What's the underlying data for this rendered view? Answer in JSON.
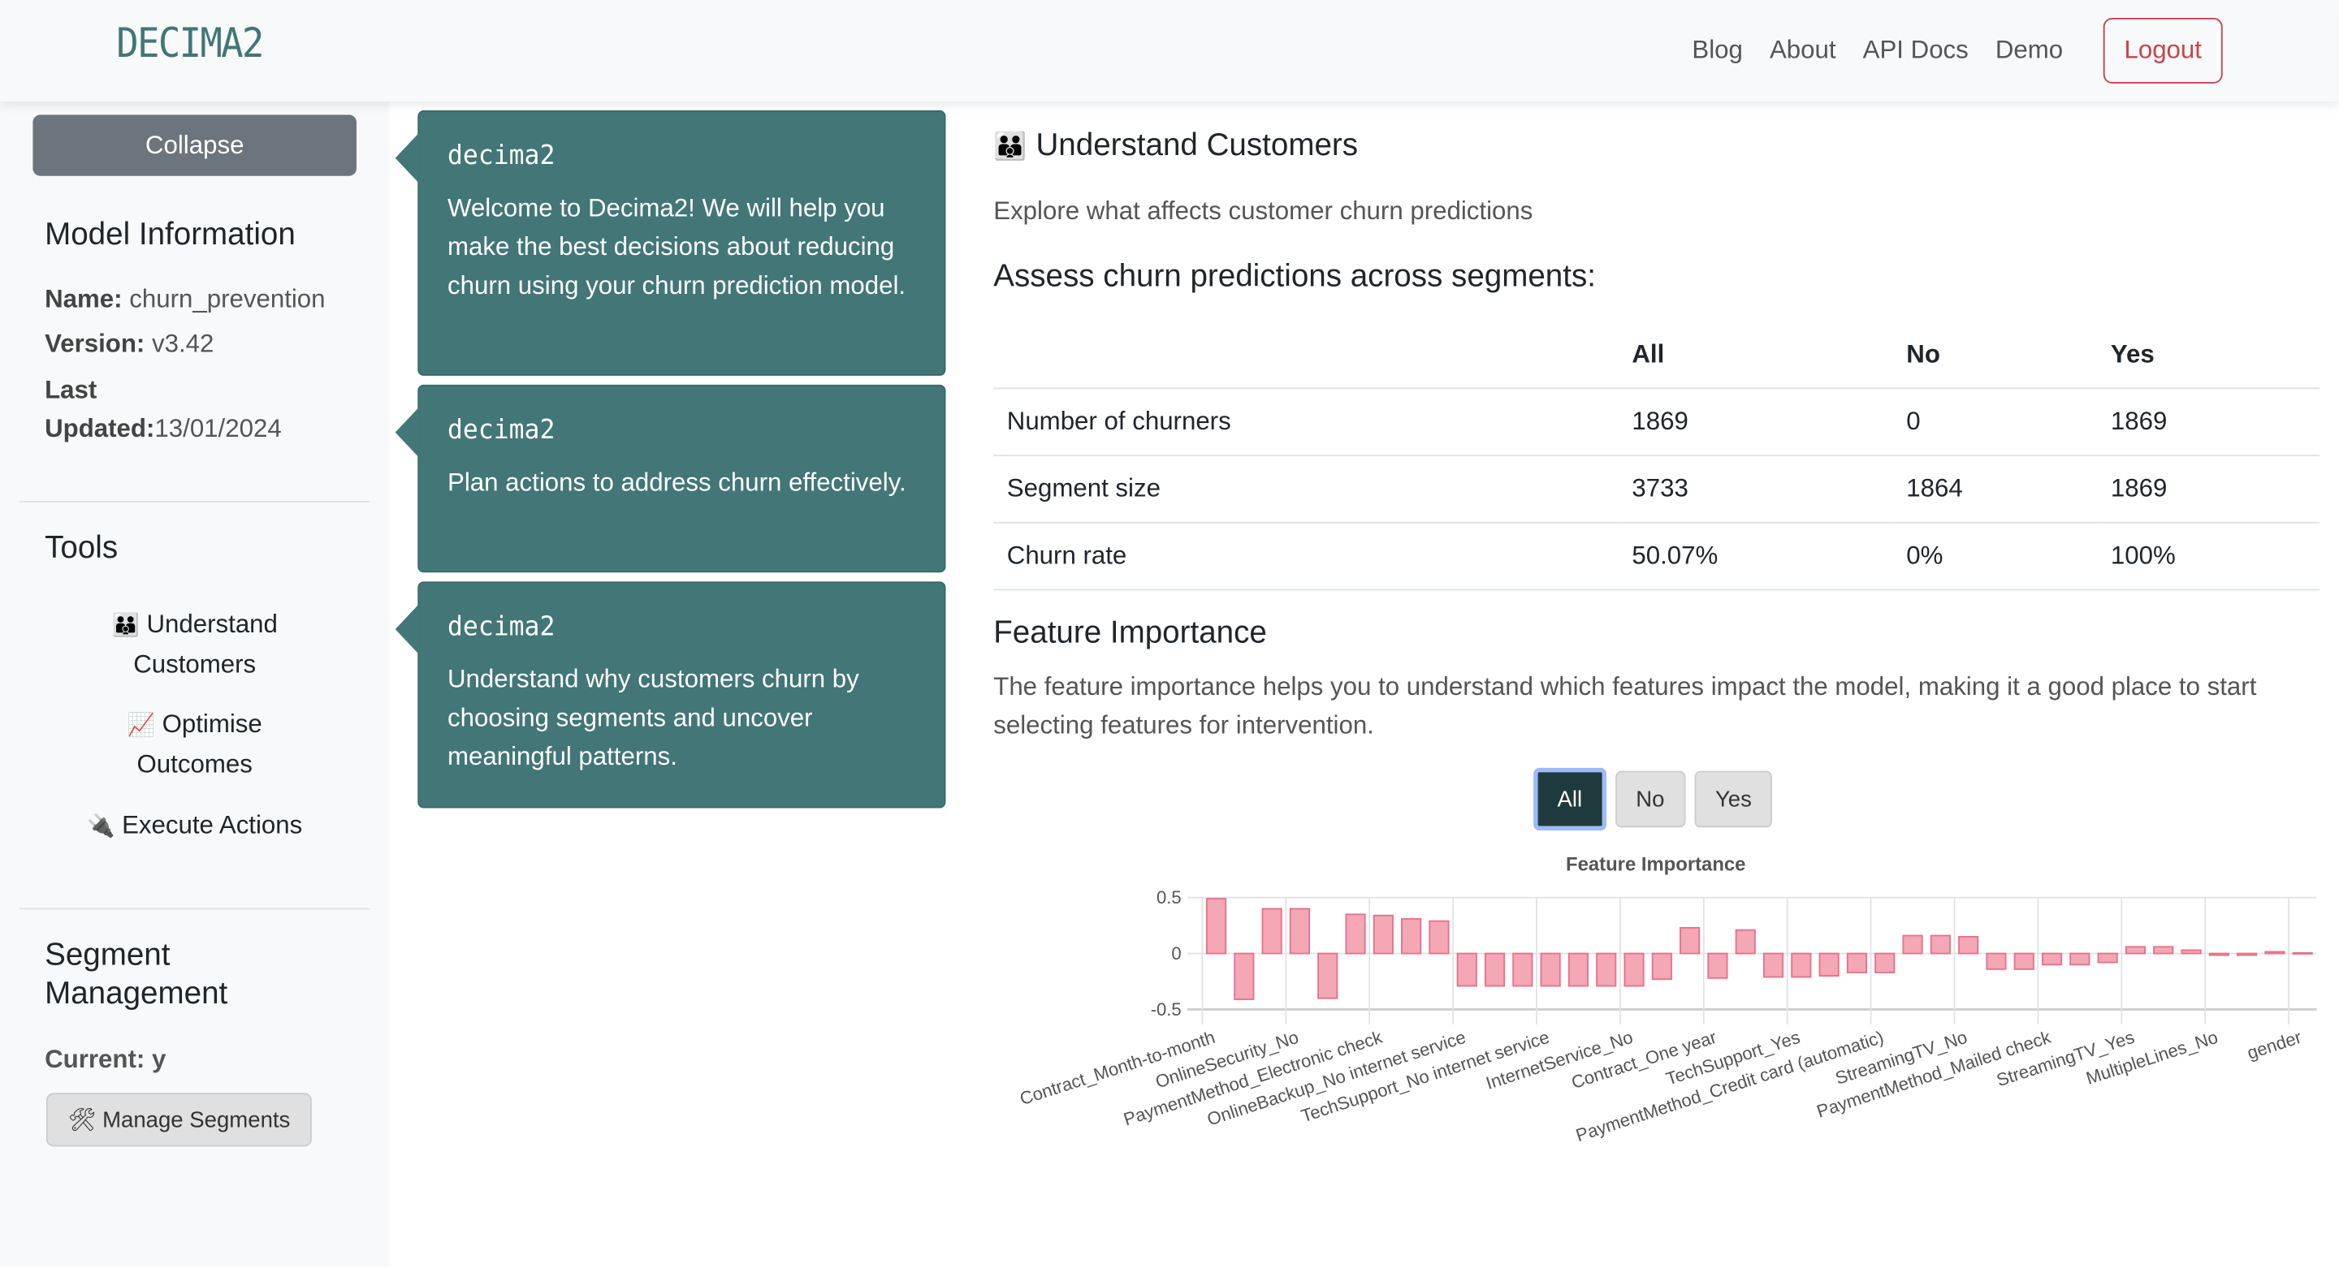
{
  "navbar": {
    "brand": "DECIMA2",
    "links": [
      "Blog",
      "About",
      "API Docs",
      "Demo"
    ],
    "logout": "Logout"
  },
  "sidebar": {
    "collapse": "Collapse",
    "model_info": {
      "heading": "Model Information",
      "name_label": "Name:",
      "name_value": "churn_prevention",
      "version_label": "Version:",
      "version_value": "v3.42",
      "updated_label_1": "Last",
      "updated_label_2": "Updated:",
      "updated_value": "13/01/2024"
    },
    "tools": {
      "heading": "Tools",
      "items": [
        {
          "icon": "👪",
          "icon_name": "family-icon",
          "line1": "Understand",
          "line2": "Customers"
        },
        {
          "icon": "📈",
          "icon_name": "chart-increasing-icon",
          "line1": "Optimise",
          "line2": "Outcomes"
        },
        {
          "icon": "🔌",
          "icon_name": "plug-icon",
          "line1": "Execute Actions",
          "line2": ""
        }
      ]
    },
    "segment": {
      "heading_1": "Segment",
      "heading_2": "Management",
      "current_label": "Current:",
      "current_value": "y",
      "manage_icon": "🛠",
      "manage_label": "Manage Segments"
    }
  },
  "chat": [
    {
      "author": "decima2",
      "text": "Welcome to Decima2! We will help you make the best decisions about reducing churn using your churn prediction model."
    },
    {
      "author": "decima2",
      "text": "Plan actions to address churn effectively."
    },
    {
      "author": "decima2",
      "text": "Understand why customers churn by choosing segments and uncover meaningful patterns."
    }
  ],
  "main": {
    "title_icon": "👪",
    "title": "Understand Customers",
    "subtitle": "Explore what affects customer churn predictions",
    "assess_heading": "Assess churn predictions across segments:",
    "table": {
      "headers": [
        "",
        "All",
        "No",
        "Yes"
      ],
      "rows": [
        [
          "Number of churners",
          "1869",
          "0",
          "1869"
        ],
        [
          "Segment size",
          "3733",
          "1864",
          "1869"
        ],
        [
          "Churn rate",
          "50.07%",
          "0%",
          "100%"
        ]
      ]
    },
    "fi_heading": "Feature Importance",
    "fi_text": "The feature importance helps you to understand which features impact the model, making it a good place to start selecting features for intervention.",
    "segment_buttons": [
      "All",
      "No",
      "Yes"
    ],
    "active_segment": "All"
  },
  "chart_data": {
    "type": "bar",
    "title": "Feature Importance",
    "xlabel": "",
    "ylabel": "",
    "ylim": [
      -0.5,
      0.5
    ],
    "yticks": [
      0.5,
      0,
      -0.5
    ],
    "ytick_labels": [
      "0.5",
      "0",
      "-0.5"
    ],
    "grid": true,
    "bar_color": "#f4a7b5",
    "bar_edge_color": "#e8708a",
    "label_every": 3,
    "categories": [
      "Contract_Month-to-month",
      "",
      "",
      "OnlineSecurity_No",
      "",
      "",
      "PaymentMethod_Electronic check",
      "",
      "",
      "OnlineBackup_No internet service",
      "",
      "",
      "TechSupport_No internet service",
      "",
      "",
      "InternetService_No",
      "",
      "",
      "Contract_One year",
      "",
      "",
      "TechSupport_Yes",
      "",
      "",
      "PaymentMethod_Credit card (automatic)",
      "",
      "",
      "StreamingTV_No",
      "",
      "",
      "PaymentMethod_Mailed check",
      "",
      "",
      "StreamingTV_Yes",
      "",
      "",
      "MultipleLines_No",
      "",
      "",
      "gender"
    ],
    "values": [
      0.49,
      -0.41,
      0.4,
      0.4,
      -0.4,
      0.35,
      0.34,
      0.31,
      0.29,
      -0.29,
      -0.29,
      -0.29,
      -0.29,
      -0.29,
      -0.29,
      -0.29,
      -0.23,
      0.23,
      -0.22,
      0.21,
      -0.21,
      -0.21,
      -0.2,
      -0.17,
      -0.17,
      0.16,
      0.16,
      0.15,
      -0.14,
      -0.14,
      -0.1,
      -0.1,
      -0.08,
      0.06,
      0.06,
      0.03,
      -0.015,
      -0.015,
      0.015,
      0.005
    ]
  }
}
